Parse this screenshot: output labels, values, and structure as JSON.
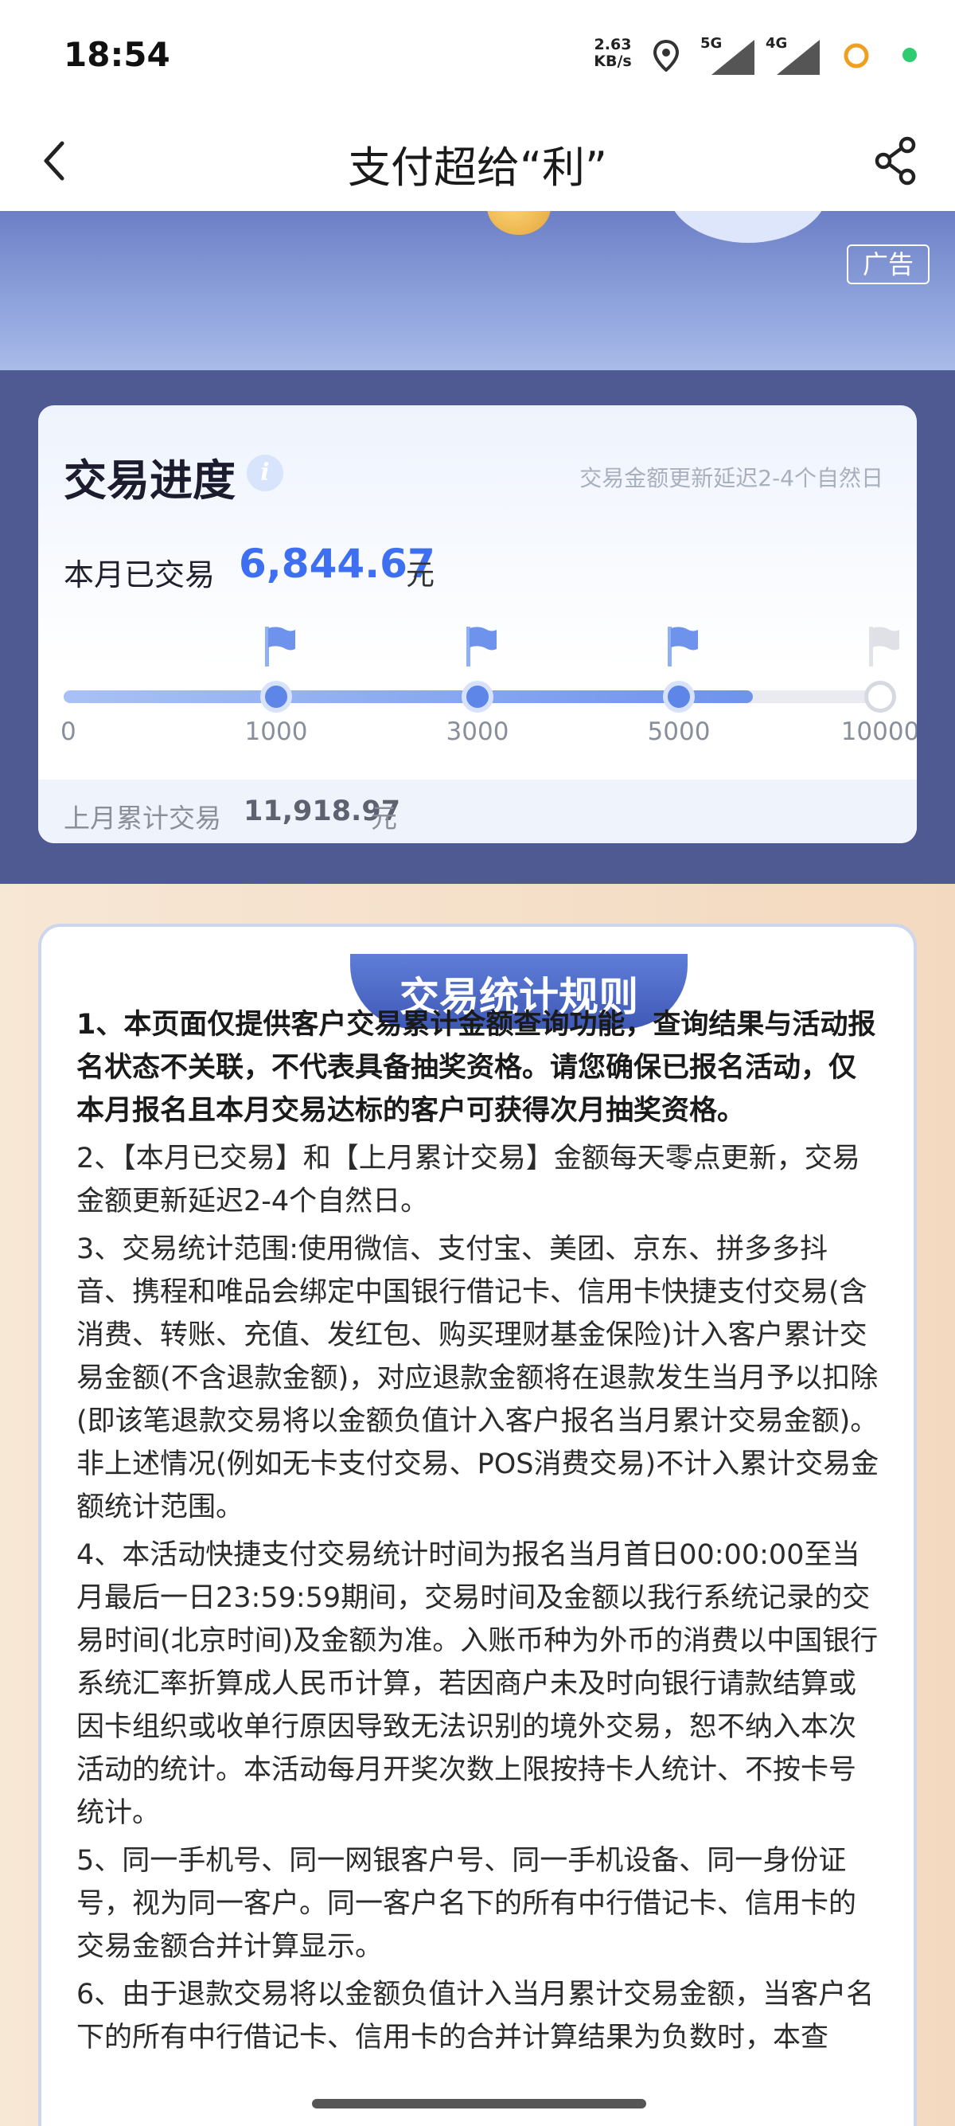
{
  "status_bar": {
    "time": "18:54",
    "net_speed_value": "2.63",
    "net_speed_unit": "KB/s",
    "signal_1": "5G",
    "signal_2": "4G"
  },
  "nav": {
    "title": "支付超给“利”"
  },
  "banner": {
    "ad_badge": "广告"
  },
  "progress": {
    "title": "交易进度",
    "info_glyph": "i",
    "delay_note": "交易金额更新延迟2-4个自然日",
    "month_label": "本月已交易",
    "month_amount": "6,844.67",
    "month_amount_value": 6844.67,
    "unit": "元",
    "milestones": [
      {
        "label": "0",
        "value": 0,
        "reached": true,
        "flag": false
      },
      {
        "label": "1000",
        "value": 1000,
        "reached": true,
        "flag": true
      },
      {
        "label": "3000",
        "value": 3000,
        "reached": true,
        "flag": true
      },
      {
        "label": "5000",
        "value": 5000,
        "reached": true,
        "flag": true
      },
      {
        "label": "10000",
        "value": 10000,
        "reached": false,
        "flag": true
      }
    ],
    "last_month_label": "上月累计交易",
    "last_month_amount": "11,918.97",
    "last_month_unit": "元"
  },
  "rules": {
    "header": "交易统计规则",
    "paragraphs": [
      {
        "text": "1、本页面仅提供客户交易累计金额查询功能，查询结果与活动报名状态不关联，不代表具备抽奖资格。请您确保已报名活动，仅本月报名且本月交易达标的客户可获得次月抽奖资格。",
        "bold": true
      },
      {
        "text": "2、【本月已交易】和【上月累计交易】金额每天零点更新，交易金额更新延迟2-4个自然日。",
        "bold": false
      },
      {
        "text": "3、交易统计范围:使用微信、支付宝、美团、京东、拼多多抖音、携程和唯品会绑定中国银行借记卡、信用卡快捷支付交易(含消费、转账、充值、发红包、购买理财基金保险)计入客户累计交易金额(不含退款金额)，对应退款金额将在退款发生当月予以扣除(即该笔退款交易将以金额负值计入客户报名当月累计交易金额)。非上述情况(例如无卡支付交易、POS消费交易)不计入累计交易金额统计范围。",
        "bold": false
      },
      {
        "text": "4、本活动快捷支付交易统计时间为报名当月首日00:00:00至当月最后一日23:59:59期间，交易时间及金额以我行系统记录的交易时间(北京时间)及金额为准。入账币种为外币的消费以中国银行系统汇率折算成人民币计算，若因商户未及时向银行请款结算或因卡组织或收单行原因导致无法识别的境外交易，恕不纳入本次活动的统计。本活动每月开奖次数上限按持卡人统计、不按卡号统计。",
        "bold": false
      },
      {
        "text": "5、同一手机号、同一网银客户号、同一手机设备、同一身份证号，视为同一客户。同一客户名下的所有中行借记卡、信用卡的交易金额合并计算显示。",
        "bold": false
      },
      {
        "text": "6、由于退款交易将以金额负值计入当月累计交易金额，当客户名下的所有中行借记卡、信用卡的合并计算结果为负数时，本查",
        "bold": false
      }
    ]
  },
  "colors": {
    "accent": "#3f6ff1",
    "section_bg": "#4f5a92",
    "rules_bg": "#f3d9bf"
  }
}
